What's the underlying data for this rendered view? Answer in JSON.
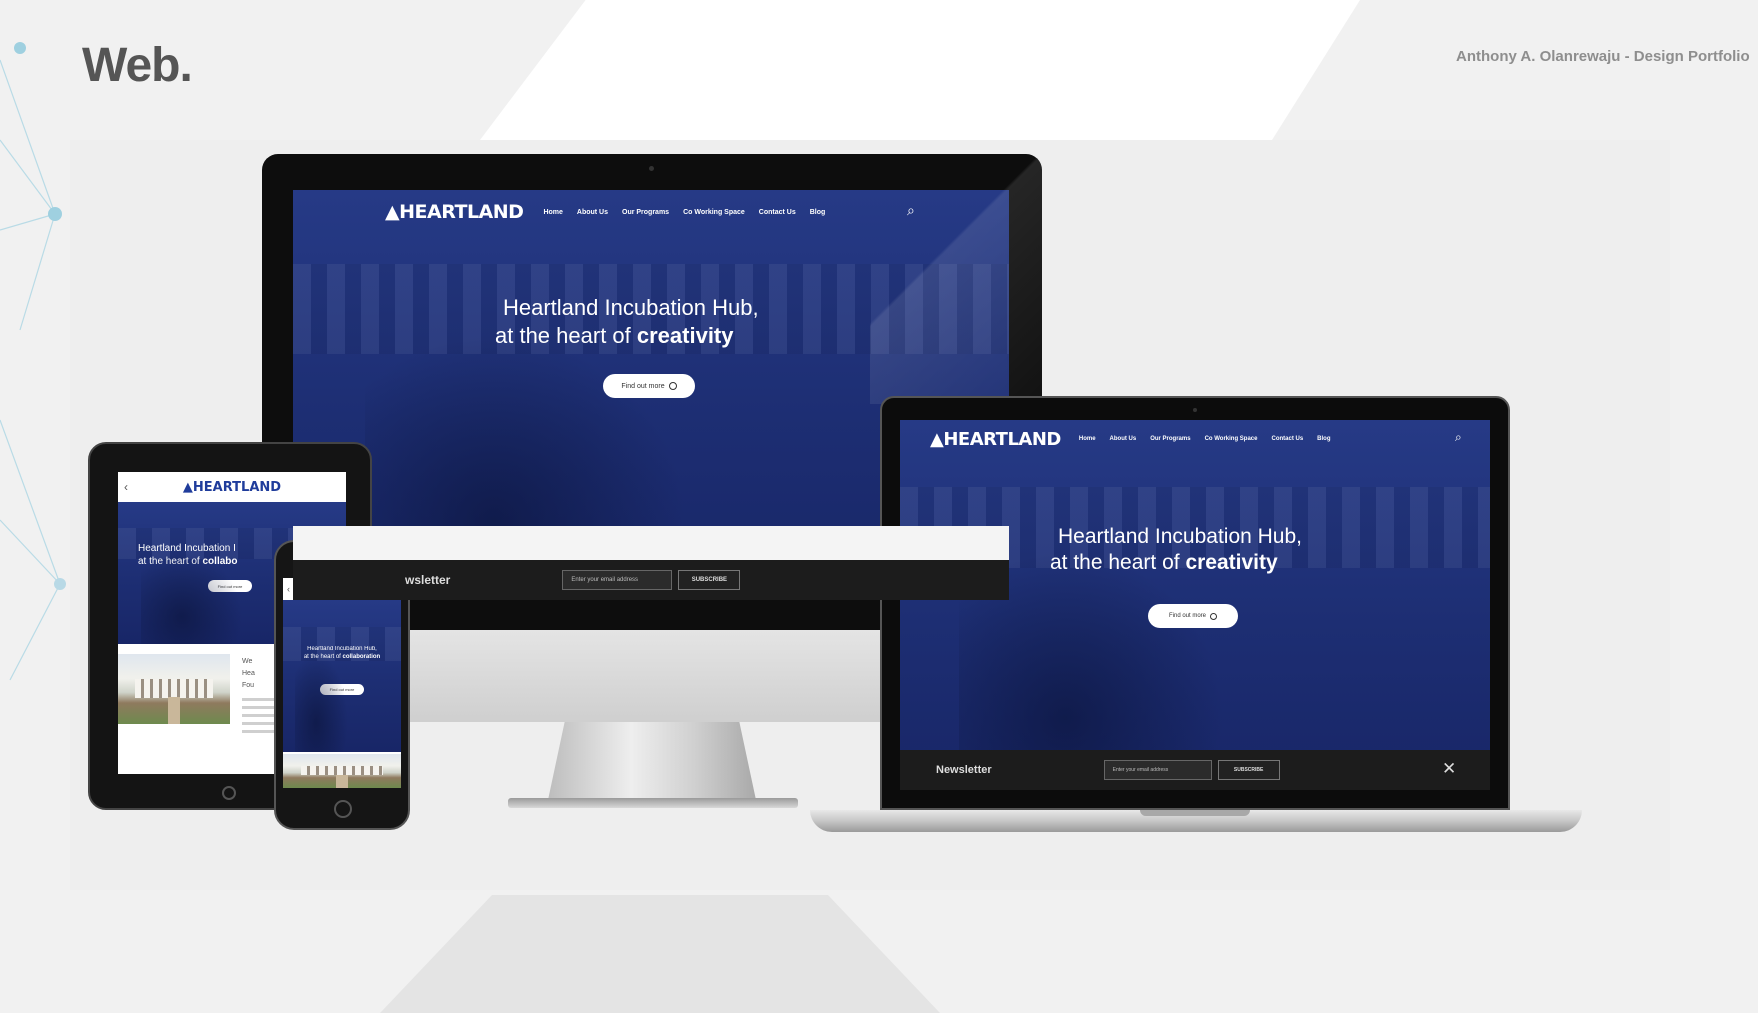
{
  "page": {
    "title": "Web.",
    "author": "Anthony A. Olanrewaju - Design Portfolio"
  },
  "site": {
    "logo": "HEARTLAND",
    "nav": [
      "Home",
      "About Us",
      "Our Programs",
      "Co Working Space",
      "Contact Us",
      "Blog"
    ],
    "hero_line1": "Heartland Incubation Hub,",
    "hero_line2_prefix": "at the heart of ",
    "hero_line2_bold": "creativity",
    "cta": "Find out more",
    "newsletter_label": "Newsletter",
    "newsletter_label_cropped": "wsletter",
    "email_placeholder": "Enter your email address",
    "subscribe": "SUBSCRIBE",
    "close": "✕"
  },
  "tablet": {
    "hero_line1": "Heartland Incubation I",
    "hero_line2_prefix": "at the heart of ",
    "hero_line2_bold": "collabo",
    "cta": "Find out more",
    "side_text": [
      "We",
      "Hea",
      "Fou"
    ]
  },
  "phone": {
    "hero_line1": "Heartland Incubation Hub,",
    "hero_line2_prefix": "at the heart of ",
    "hero_line2_bold": "collaboration",
    "cta": "Find out more"
  },
  "icons": {
    "search": "⌕",
    "apple": "",
    "back": "‹"
  },
  "colors": {
    "site_blue": "#1f2f78",
    "logo_blue": "#1f3c9b",
    "newsletter_bar": "#1c1c1c"
  }
}
